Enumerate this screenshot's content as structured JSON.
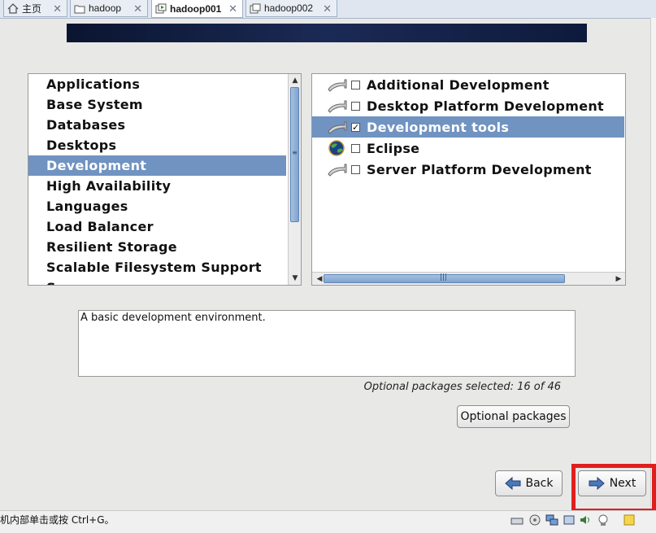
{
  "tabs": [
    {
      "label": "主页",
      "icon": "home-icon"
    },
    {
      "label": "hadoop",
      "icon": "folder-icon"
    },
    {
      "label": "hadoop001",
      "icon": "vm-icon"
    },
    {
      "label": "hadoop002",
      "icon": "vm-icon"
    }
  ],
  "groups": [
    "Applications",
    "Base System",
    "Databases",
    "Desktops",
    "Development",
    "High Availability",
    "Languages",
    "Load Balancer",
    "Resilient Storage",
    "Scalable Filesystem Support",
    "S"
  ],
  "selected_group": "Development",
  "packages": [
    {
      "label": "Additional Development",
      "checked": false,
      "icon": "package-group-icon"
    },
    {
      "label": "Desktop Platform Development",
      "checked": false,
      "icon": "package-group-icon"
    },
    {
      "label": "Development tools",
      "checked": true,
      "icon": "package-group-icon"
    },
    {
      "label": "Eclipse",
      "checked": false,
      "icon": "eclipse-globe-icon"
    },
    {
      "label": "Server Platform Development",
      "checked": false,
      "icon": "package-group-icon"
    }
  ],
  "description": "A basic development environment.",
  "optional_info": "Optional packages selected: 16 of 46",
  "buttons": {
    "optional_packages": "Optional packages",
    "back": "Back",
    "next": "Next"
  },
  "status": {
    "text": "机内部单击或按 Ctrl+G。"
  },
  "colors": {
    "selection": "#7093c1",
    "highlight_border": "#e01e1e"
  }
}
